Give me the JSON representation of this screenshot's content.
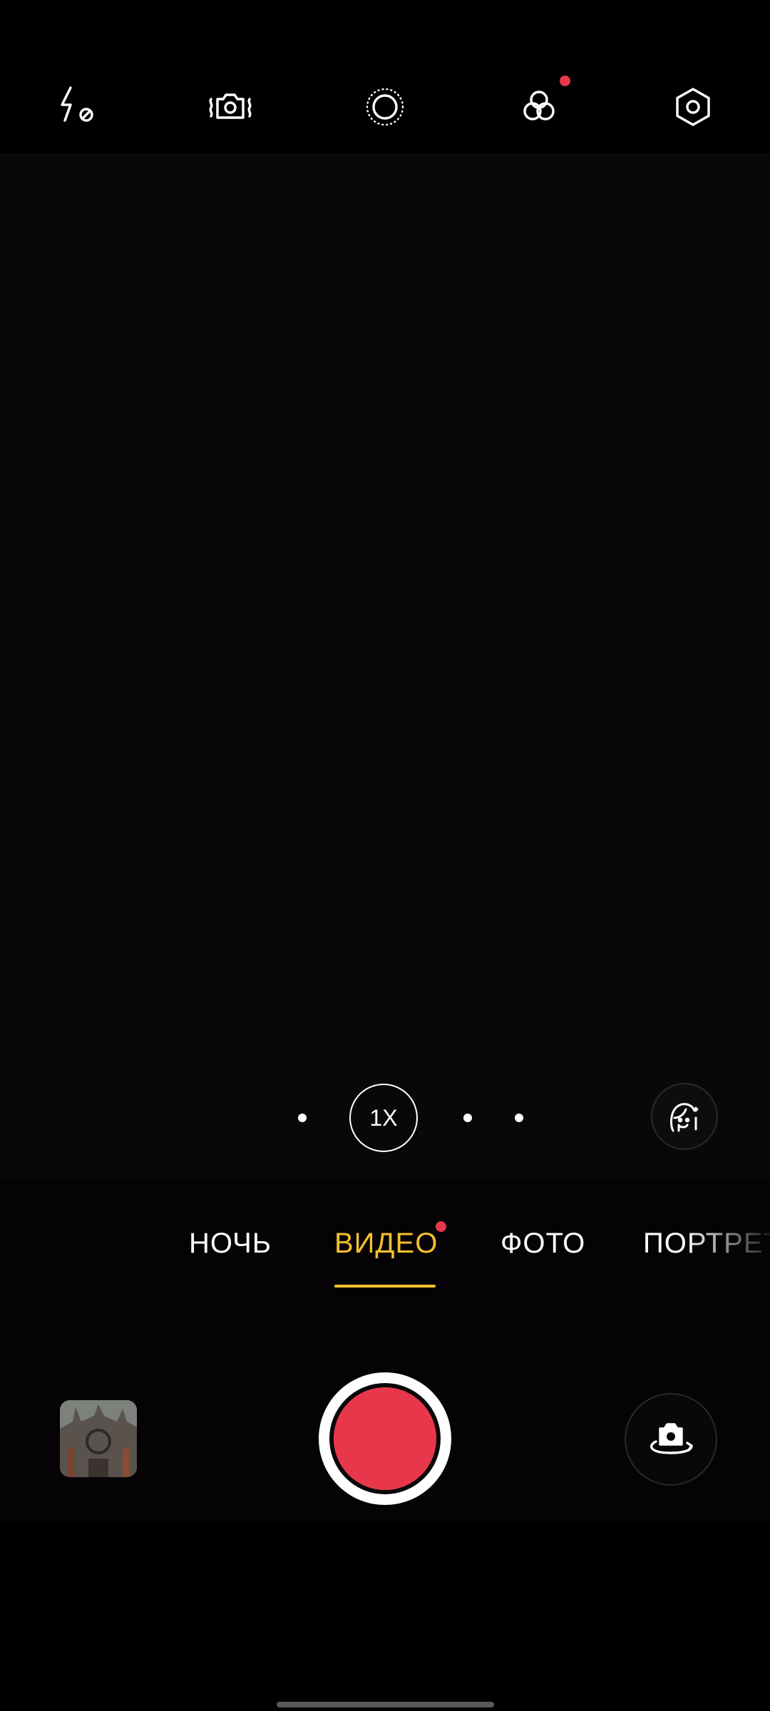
{
  "colors": {
    "accent_active": "#f4c12d",
    "notification_dot": "#e8374a",
    "record_button": "#e8374a"
  },
  "toolbar": {
    "icons": [
      "flash-off-icon",
      "camera-stabilization-icon",
      "live-photo-icon",
      "filters-icon",
      "settings-icon"
    ],
    "filters_has_notification": true
  },
  "zoom": {
    "current_label": "1X",
    "options_count": 4
  },
  "modes": {
    "items": [
      {
        "label": "НОЧЬ",
        "active": false
      },
      {
        "label": "ВИДЕО",
        "active": true,
        "has_notification": true
      },
      {
        "label": "ФОТО",
        "active": false
      },
      {
        "label": "ПОРТРЕТ",
        "active": false
      }
    ]
  },
  "controls": {
    "gallery_icon": "gallery-thumbnail",
    "shutter_icon": "record-icon",
    "switch_icon": "switch-camera-icon",
    "beauty_icon": "beauty-face-icon"
  }
}
